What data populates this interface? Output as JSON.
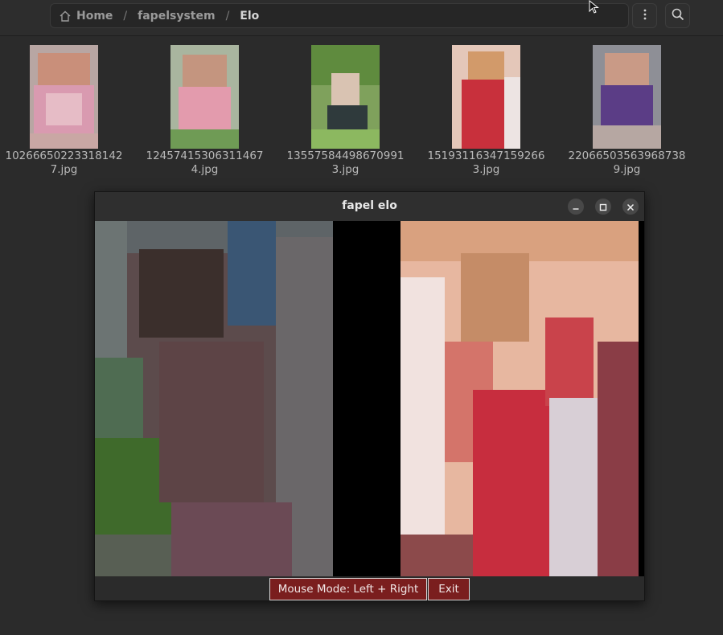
{
  "breadcrumb": {
    "home": "Home",
    "folder": "fapelsystem",
    "current": "Elo"
  },
  "files": [
    {
      "name_line1": "10266650223318142",
      "name_line2": "7.jpg"
    },
    {
      "name_line1": "12457415306311467",
      "name_line2": "4.jpg"
    },
    {
      "name_line1": "13557584498670991",
      "name_line2": "3.jpg"
    },
    {
      "name_line1": "15193116347159266",
      "name_line2": "3.jpg"
    },
    {
      "name_line1": "22066503563968738",
      "name_line2": "9.jpg"
    }
  ],
  "dialog": {
    "title": "fapel elo",
    "mouse_mode_label": "Mouse Mode: Left + Right",
    "exit_label": "Exit"
  },
  "colors": {
    "accent_button": "#7a1e1e"
  }
}
